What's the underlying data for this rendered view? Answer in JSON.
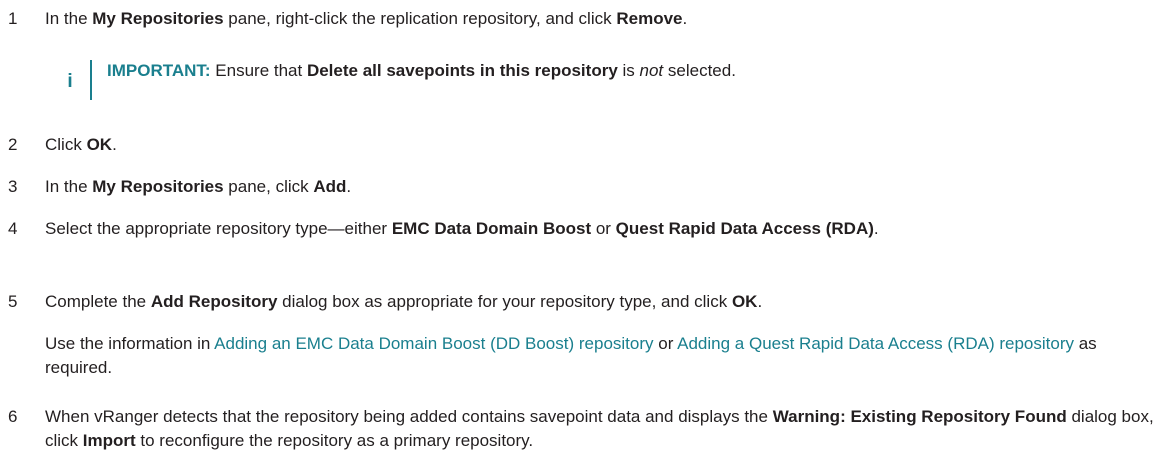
{
  "steps": [
    {
      "number": "1",
      "parts": [
        "In the ",
        "My Repositories",
        " pane, right-click the replication repository, and click ",
        "Remove",
        "."
      ]
    },
    {
      "number": "2",
      "parts": [
        "Click ",
        "OK",
        "."
      ]
    },
    {
      "number": "3",
      "parts": [
        "In the ",
        "My Repositories",
        " pane, click ",
        "Add",
        "."
      ]
    },
    {
      "number": "4",
      "parts": [
        "Select the appropriate repository type—either ",
        "EMC Data Domain Boost",
        " or ",
        "Quest Rapid Data Access (RDA)",
        "."
      ]
    },
    {
      "number": "5",
      "parts": [
        "Complete the ",
        "Add Repository",
        " dialog box as appropriate for your repository type, and click ",
        "OK",
        "."
      ],
      "followup": {
        "parts": [
          "Use the information in ",
          "Adding an EMC Data Domain Boost (DD Boost) repository",
          " or ",
          "Adding a Quest Rapid Data Access (RDA) repository",
          " as required."
        ]
      }
    },
    {
      "number": "6",
      "parts": [
        "When vRanger detects that the repository being added contains savepoint data and displays the ",
        "Warning: Existing Repository Found",
        " dialog box, click ",
        "Import",
        " to reconfigure the repository as a primary repository."
      ]
    }
  ],
  "note": {
    "icon": "info-icon",
    "label": "IMPORTANT:",
    "parts": [
      " Ensure that ",
      "Delete all savepoints in this repository",
      " is ",
      "not",
      " selected."
    ]
  },
  "colors": {
    "text": "#231f20",
    "accent": "#1a7f8e"
  }
}
